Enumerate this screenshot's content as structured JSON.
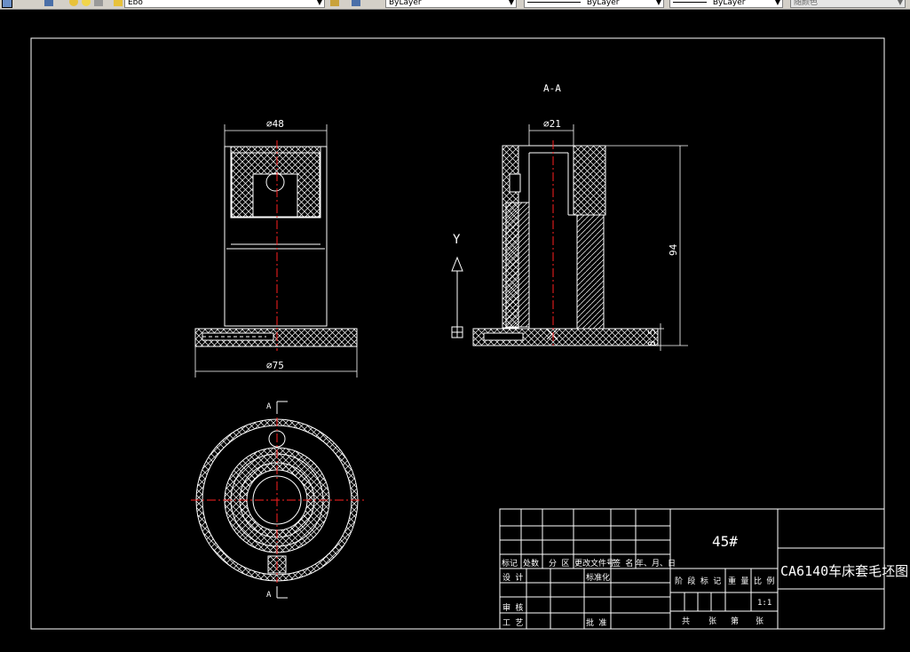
{
  "toolbar": {
    "layer_name": "Ebo",
    "color_select": "ByLayer",
    "linetype_select": "ByLayer",
    "lineweight_select": "ByLayer",
    "plotstyle_select": "随颜色"
  },
  "drawing": {
    "section_label": "A-A",
    "dim_top_diameter": "⌀48",
    "dim_base_diameter": "⌀75",
    "dim_bore_diameter": "⌀21",
    "dim_height": "94",
    "dim_flange": "8.5",
    "ucs_y": "Y",
    "cut_label_top": "A",
    "cut_label_bottom": "A"
  },
  "title_block": {
    "material": "45#",
    "drawing_title": "CA6140车床套毛坯图",
    "col_mark": "标记",
    "col_count": "处数",
    "col_zone": "分 区",
    "col_change_doc": "更改文件号",
    "col_signature": "签 名",
    "col_date": "年、月、日",
    "row_design": "设 计",
    "row_standardize": "标准化",
    "row_review": "审 核",
    "row_process": "工 艺",
    "row_approve": "批 准",
    "stage_mark": "阶 段 标 记",
    "weight": "重 量",
    "scale_label": "比 例",
    "scale_value": "1:1",
    "sheets_total": "共",
    "sheet_unit": "张",
    "sheet_no": "第",
    "sheet_unit2": "张"
  }
}
